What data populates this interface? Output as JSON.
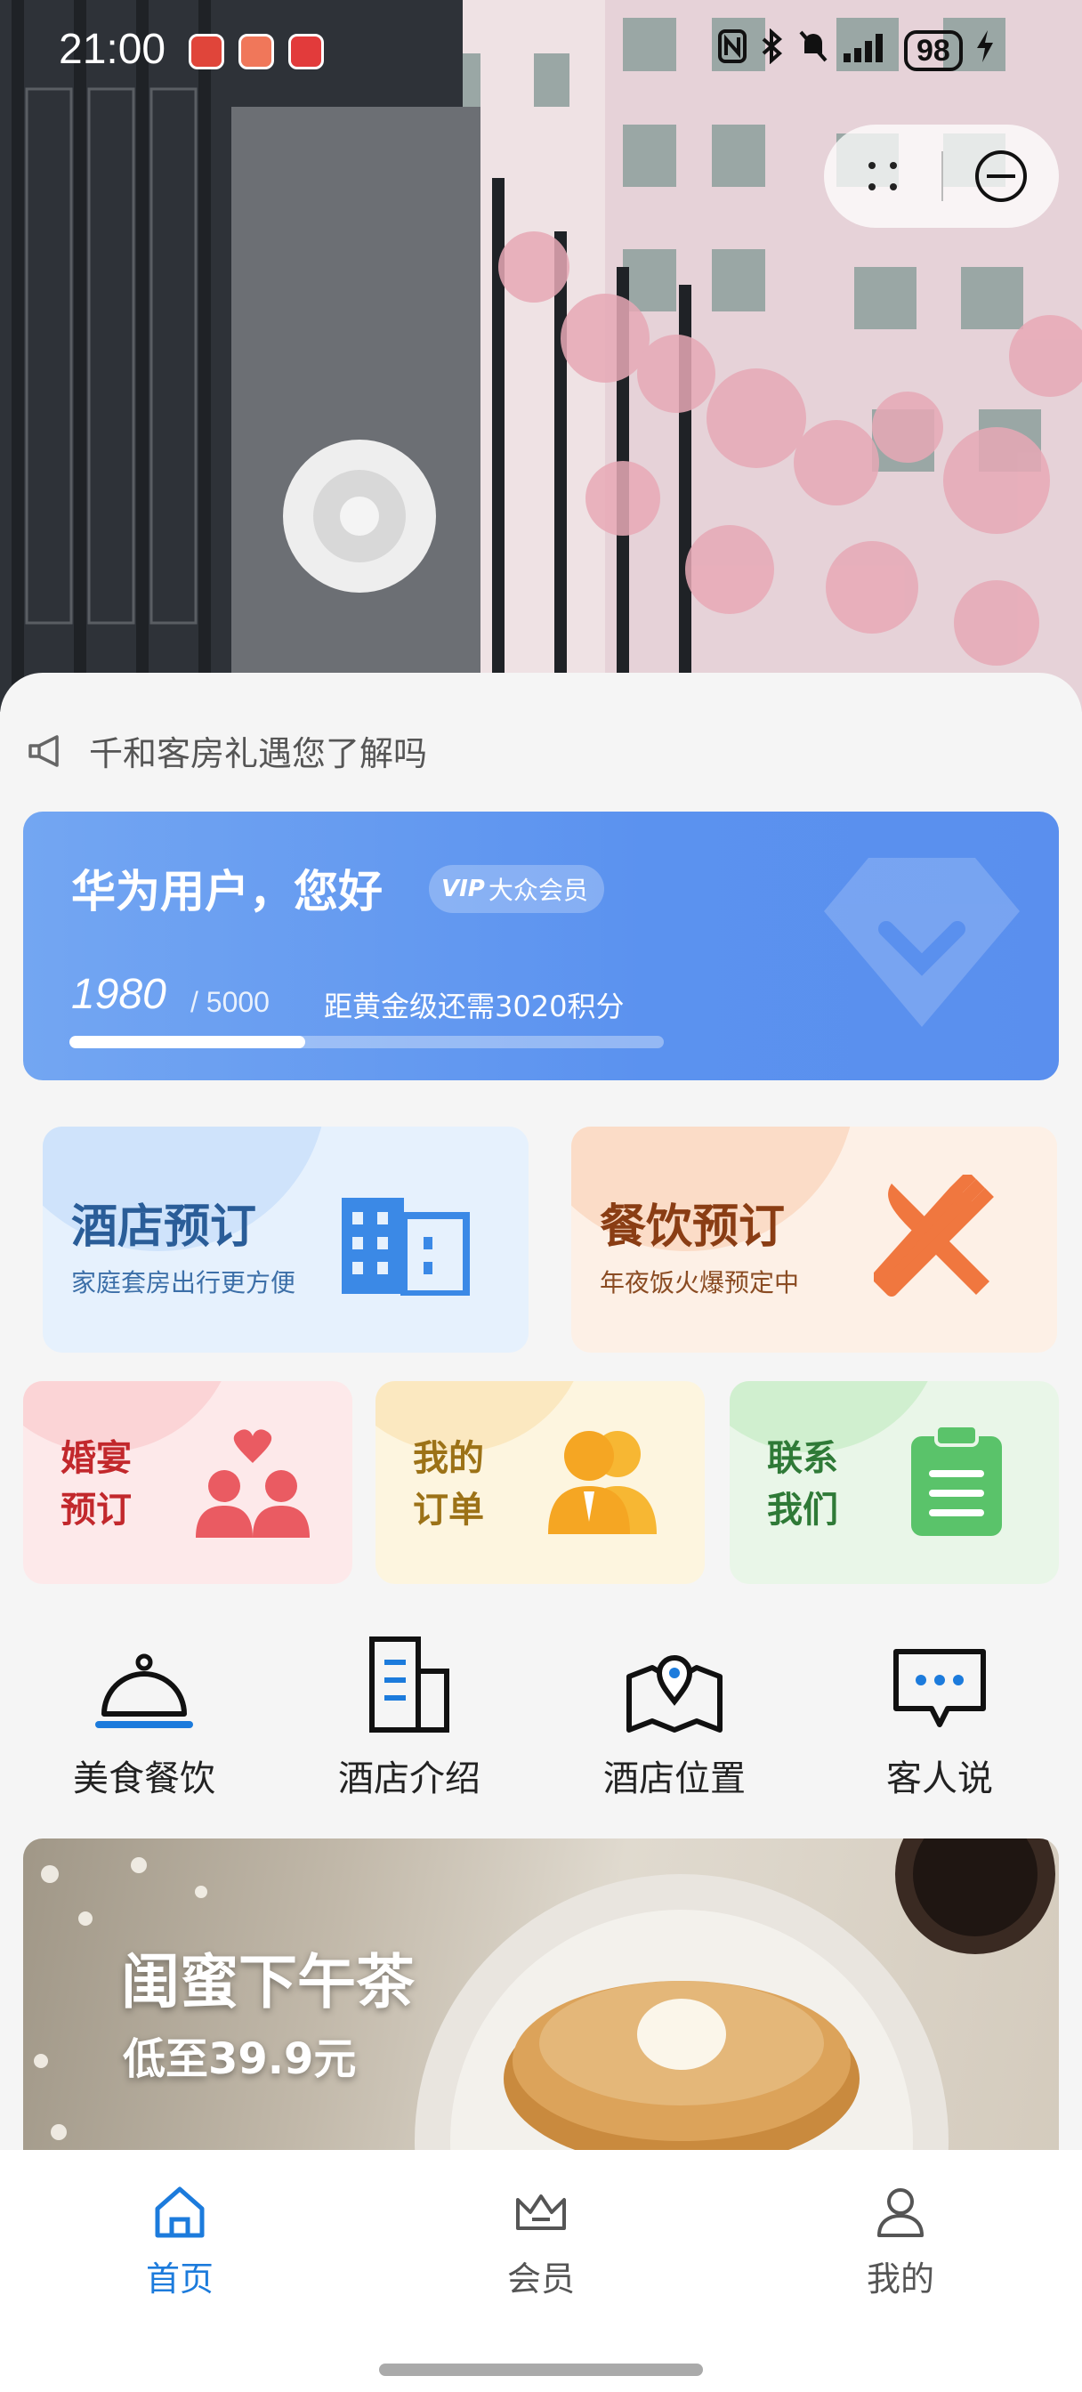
{
  "status_bar": {
    "time": "21:00",
    "battery": "98",
    "icons": [
      "nfc-icon",
      "bluetooth-icon",
      "mute-icon",
      "signal-icon",
      "charging-icon"
    ]
  },
  "capsule": {
    "more_icon": "more-dots-icon",
    "close_icon": "close-circle-icon"
  },
  "notice": {
    "icon": "megaphone-icon",
    "text": "千和客房礼遇您了解吗"
  },
  "member_card": {
    "greeting": "华为用户，您好",
    "level": "大众会员",
    "vip_icon": "VIP",
    "points": "1980",
    "points_total": "/ 5000",
    "next_level_hint": "距黄金级还需3020积分",
    "progress_fraction": 0.396
  },
  "tiles": {
    "hotel": {
      "title": "酒店预订",
      "subtitle": "家庭套房出行更方便",
      "icon": "hotel-building-icon"
    },
    "dining": {
      "title": "餐饮预订",
      "subtitle": "年夜饭火爆预定中",
      "icon": "knife-fork-icon"
    },
    "wedding": {
      "line1": "婚宴",
      "line2": "预订",
      "icon": "couple-heart-icon"
    },
    "orders": {
      "line1": "我的",
      "line2": "订单",
      "icon": "people-icon"
    },
    "contact": {
      "line1": "联系",
      "line2": "我们",
      "icon": "clipboard-icon"
    }
  },
  "quick_nav": [
    {
      "label": "美食餐饮",
      "icon": "food-cloche-icon"
    },
    {
      "label": "酒店介绍",
      "icon": "building-icon"
    },
    {
      "label": "酒店位置",
      "icon": "map-pin-icon"
    },
    {
      "label": "客人说",
      "icon": "chat-bubble-icon"
    }
  ],
  "banner": {
    "title": "闺蜜下午茶",
    "subtitle": "低至39.9元"
  },
  "tabbar": [
    {
      "label": "首页",
      "icon": "home-icon",
      "active": true
    },
    {
      "label": "会员",
      "icon": "crown-icon",
      "active": false
    },
    {
      "label": "我的",
      "icon": "user-icon",
      "active": false
    }
  ],
  "colors": {
    "accent": "#1c7bdc",
    "member_card": "#5b92ef",
    "hotel_tile": "#e6f1fd",
    "dining_tile": "#fdf0e6",
    "wedding_tile": "#fde9ea",
    "orders_tile": "#fdf5df",
    "contact_tile": "#e9f6e8"
  }
}
